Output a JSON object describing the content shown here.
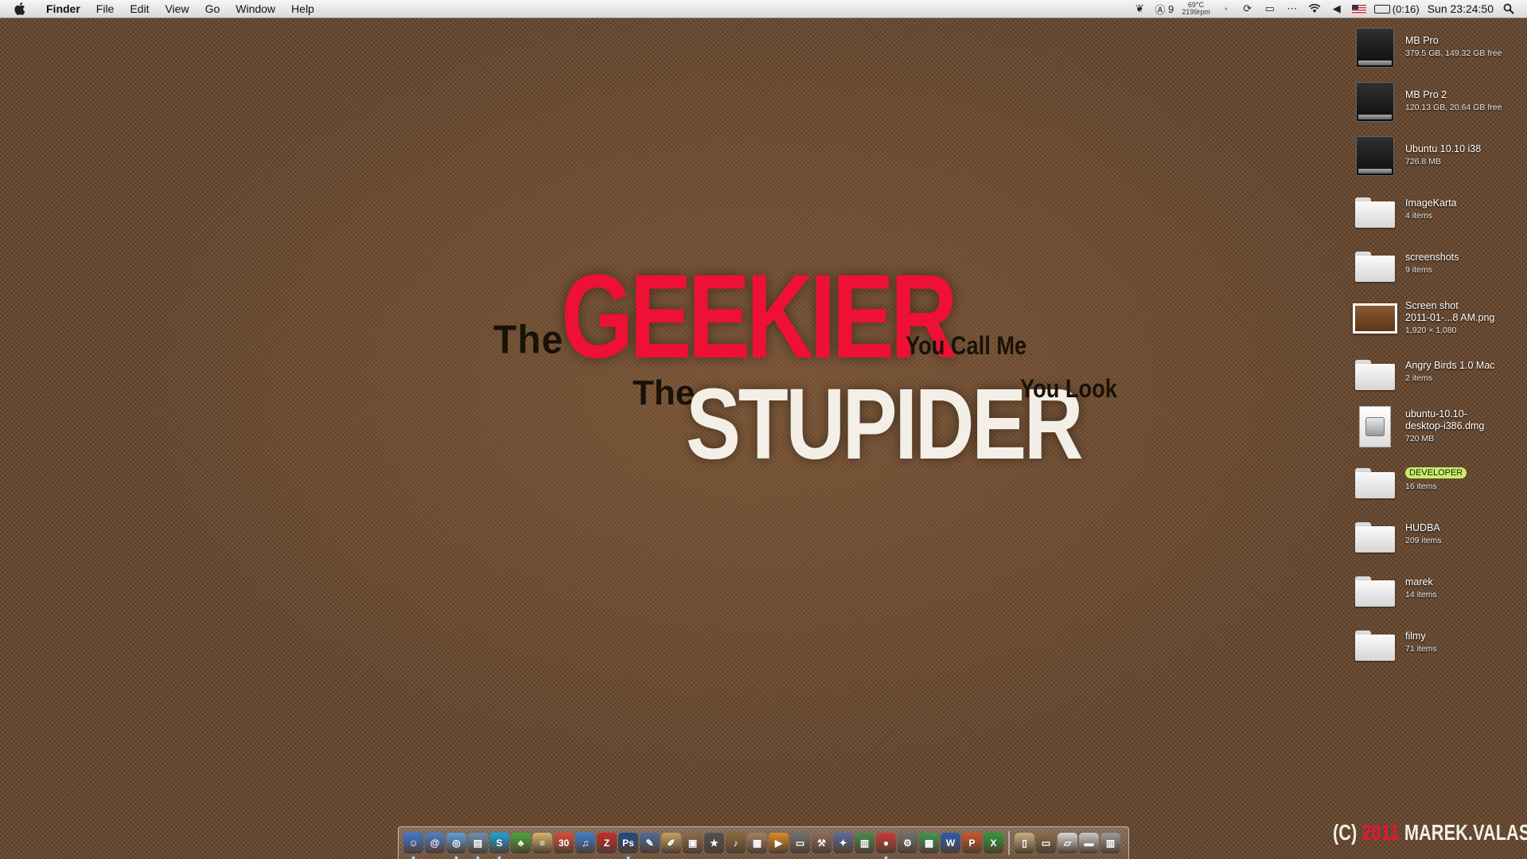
{
  "menubar": {
    "app_name": "Finder",
    "menus": [
      "File",
      "Edit",
      "View",
      "Go",
      "Window",
      "Help"
    ],
    "extras": {
      "badge_count": "9",
      "temperature": "69°C",
      "fan_speed": "2199rpm",
      "battery": "(0:16)",
      "clock": "Sun 23:24:50"
    }
  },
  "wallpaper": {
    "line1": {
      "the": "The",
      "big": "GEEKIER",
      "tail": "You Call Me"
    },
    "line2": {
      "the": "The",
      "big": "STUPIDER",
      "tail": "You Look"
    },
    "copyright": {
      "prefix": "(C) ",
      "year": "2011",
      "author": " MAREK.VALASIK"
    }
  },
  "desktop_icons": [
    {
      "kind": "drive-apple",
      "name": "MB Pro",
      "info": "379.5 GB, 149.32 GB free"
    },
    {
      "kind": "drive-timemachine",
      "name": "MB Pro 2",
      "info": "120.13 GB, 20.64 GB free"
    },
    {
      "kind": "drive-disk",
      "name": "Ubuntu 10.10 i38",
      "info": "726.8 MB"
    },
    {
      "kind": "folder",
      "name": "ImageKarta",
      "info": "4 items"
    },
    {
      "kind": "folder",
      "name": "screenshots",
      "info": "9 items"
    },
    {
      "kind": "image",
      "name": "Screen shot",
      "name2": "2011-01-...8 AM.png",
      "info": "1,920 × 1,080"
    },
    {
      "kind": "folder",
      "name": "Angry Birds 1.0 Mac",
      "info": "2 items"
    },
    {
      "kind": "dmg",
      "name": "ubuntu-10.10-",
      "name2": "desktop-i386.dmg",
      "info": "720 MB"
    },
    {
      "kind": "folder-labeled",
      "name": "DEVELOPER",
      "info": "16 items"
    },
    {
      "kind": "folder",
      "name": "HUDBA",
      "info": "209 items"
    },
    {
      "kind": "folder",
      "name": "marek",
      "info": "14 items"
    },
    {
      "kind": "folder",
      "name": "filmy",
      "info": "71 items"
    }
  ],
  "dock": {
    "apps": [
      {
        "icon": "finder-icon",
        "glyph": "☺",
        "color": "#3b78d8",
        "running": true
      },
      {
        "icon": "mail-icon",
        "glyph": "@",
        "color": "#4a7fc9",
        "running": false
      },
      {
        "icon": "safari-icon",
        "glyph": "◎",
        "color": "#5aa0e0",
        "running": true
      },
      {
        "icon": "preview-icon",
        "glyph": "▤",
        "color": "#6a8fb5",
        "running": true
      },
      {
        "icon": "skype-icon",
        "glyph": "S",
        "color": "#18a4e0",
        "running": true
      },
      {
        "icon": "adium-icon",
        "glyph": "♣",
        "color": "#4aa83a",
        "running": false
      },
      {
        "icon": "notes-icon",
        "glyph": "≡",
        "color": "#d7b46a",
        "running": false
      },
      {
        "icon": "ical-icon",
        "glyph": "30",
        "color": "#d84a3a",
        "running": false
      },
      {
        "icon": "itunes-icon",
        "glyph": "♫",
        "color": "#3a7dd8",
        "running": false
      },
      {
        "icon": "filezilla-icon",
        "glyph": "Z",
        "color": "#c82828",
        "running": false
      },
      {
        "icon": "photoshop-icon",
        "glyph": "Ps",
        "color": "#1c4a8a",
        "running": true
      },
      {
        "icon": "xcode-icon",
        "glyph": "✎",
        "color": "#4a6aa0",
        "running": false
      },
      {
        "icon": "textedit-icon",
        "glyph": "✐",
        "color": "#c8a060",
        "running": false
      },
      {
        "icon": "iphoto-icon",
        "glyph": "▣",
        "color": "#8a6a4a",
        "running": false
      },
      {
        "icon": "imovie-icon",
        "glyph": "★",
        "color": "#505050",
        "running": false
      },
      {
        "icon": "garageband-icon",
        "glyph": "♪",
        "color": "#8a6a3a",
        "running": false
      },
      {
        "icon": "iweb-icon",
        "glyph": "▦",
        "color": "#a08060",
        "running": false
      },
      {
        "icon": "vlc-icon",
        "glyph": "▶",
        "color": "#e08a20",
        "running": false
      },
      {
        "icon": "scanner-icon",
        "glyph": "▭",
        "color": "#707070",
        "running": false
      },
      {
        "icon": "utility-icon",
        "glyph": "⚒",
        "color": "#8a6a5a",
        "running": false
      },
      {
        "icon": "instruments-icon",
        "glyph": "✦",
        "color": "#5a6a9a",
        "running": false
      },
      {
        "icon": "charts-icon",
        "glyph": "▥",
        "color": "#4a8a4a",
        "running": false
      },
      {
        "icon": "reeder-icon",
        "glyph": "●",
        "color": "#c83a3a",
        "running": true
      },
      {
        "icon": "automator-icon",
        "glyph": "⚙",
        "color": "#707070",
        "running": false
      },
      {
        "icon": "numbers-icon",
        "glyph": "▩",
        "color": "#3a9a4a",
        "running": false
      },
      {
        "icon": "word-icon",
        "glyph": "W",
        "color": "#2a5ab0",
        "running": false
      },
      {
        "icon": "powerpoint-icon",
        "glyph": "P",
        "color": "#d0542a",
        "running": false
      },
      {
        "icon": "excel-icon",
        "glyph": "X",
        "color": "#2a9a3a",
        "running": false
      }
    ],
    "stacks": [
      {
        "icon": "documents-stack-icon",
        "glyph": "▯",
        "color": "#c8b080"
      },
      {
        "icon": "briefcase-stack-icon",
        "glyph": "▭",
        "color": "#8a6a4a"
      },
      {
        "icon": "folder-stack-icon",
        "glyph": "▱",
        "color": "#d8d8d8"
      },
      {
        "icon": "downloads-stack-icon",
        "glyph": "▬",
        "color": "#c8c8c8"
      },
      {
        "icon": "trash-icon",
        "glyph": "▥",
        "color": "#9a9a9a"
      }
    ]
  }
}
